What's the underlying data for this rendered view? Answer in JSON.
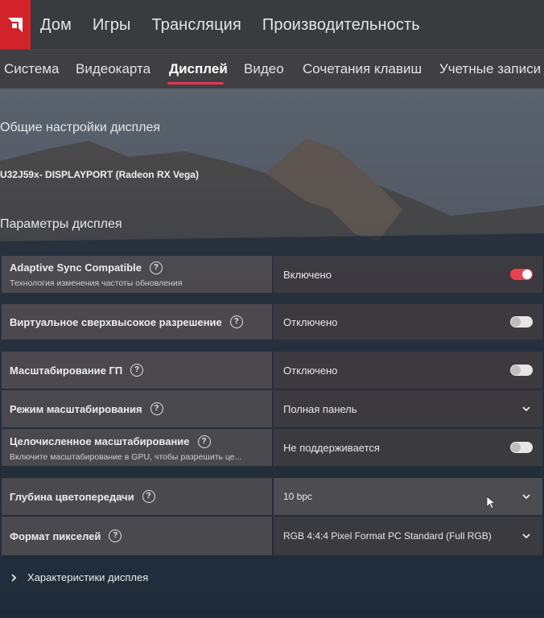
{
  "colors": {
    "accent": "#e8354a",
    "brand": "#d2232a"
  },
  "topnav": {
    "logo_icon": "amd-logo-icon",
    "items": [
      "Дом",
      "Игры",
      "Трансляция",
      "Производительность"
    ]
  },
  "subtabs": {
    "items": [
      "Система",
      "Видеокарта",
      "Дисплей",
      "Видео",
      "Сочетания клавиш",
      "Учетные записи"
    ],
    "active": "Дисплей"
  },
  "general": {
    "heading": "Общие настройки дисплея",
    "device": "U32J59x- DISPLAYPORT (Radeon RX Vega)"
  },
  "params": {
    "heading": "Параметры дисплея",
    "rows": [
      {
        "label": "Adaptive Sync Compatible",
        "sub": "Технология изменения частоты обновления",
        "value": "Включено",
        "control": "toggle-on"
      },
      {
        "label": "Виртуальное сверхвысокое разрешение",
        "sub": "",
        "value": "Отключено",
        "control": "toggle-off"
      },
      {
        "label": "Масштабирование ГП",
        "sub": "",
        "value": "Отключено",
        "control": "toggle-off"
      },
      {
        "label": "Режим масштабирования",
        "sub": "",
        "value": "Полная панель",
        "control": "dropdown"
      },
      {
        "label": "Целочисленное масштабирование",
        "sub": "Включите масштабирование в GPU, чтобы разрешить це...",
        "value": "Не поддерживается",
        "control": "toggle-off"
      },
      {
        "label": "Глубина цветопередачи",
        "sub": "",
        "value": "10 bpc",
        "control": "dropdown"
      },
      {
        "label": "Формат пикселей",
        "sub": "",
        "value": "RGB 4:4:4 Pixel Format PC Standard (Full RGB)",
        "control": "dropdown"
      }
    ],
    "help_glyph": "?"
  },
  "expander": {
    "label": "Характеристики дисплея",
    "icon": "chevron-right-icon"
  }
}
